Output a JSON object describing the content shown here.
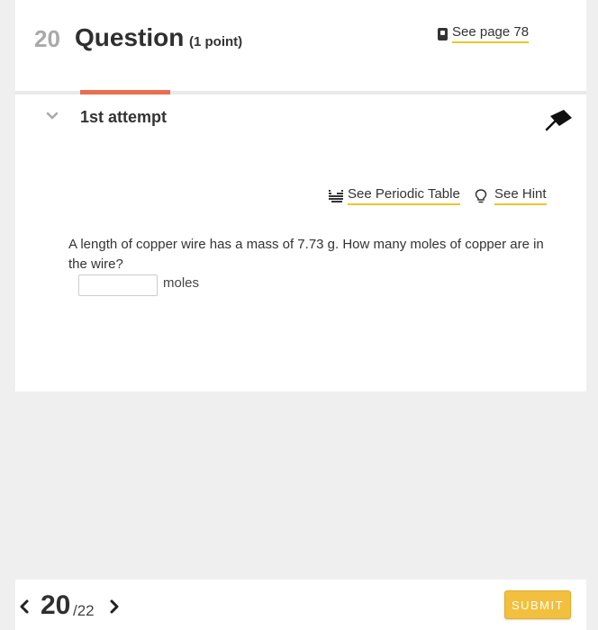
{
  "question": {
    "number": "20",
    "title": "Question",
    "points": "(1 point)",
    "see_page": "See page 78"
  },
  "attempt": {
    "title": "1st attempt"
  },
  "tools": {
    "periodic_table": "See Periodic Table",
    "hint": "See Hint"
  },
  "prompt": {
    "text": "A length of copper wire has a mass of 7.73  g. How many moles of copper are in the wire?",
    "answer_value": "",
    "unit": "moles"
  },
  "footer": {
    "current": "20",
    "total": "/22",
    "submit_label": "SUBMIT"
  },
  "colors": {
    "accent_tab": "#e96d4f",
    "link_underline": "#e9c62f",
    "submit_bg": "#f2c03e"
  },
  "icons": [
    "book-icon",
    "chevron-down-icon",
    "pin-icon",
    "periodic-table-icon",
    "lightbulb-icon",
    "chevron-left-icon",
    "chevron-right-icon"
  ]
}
